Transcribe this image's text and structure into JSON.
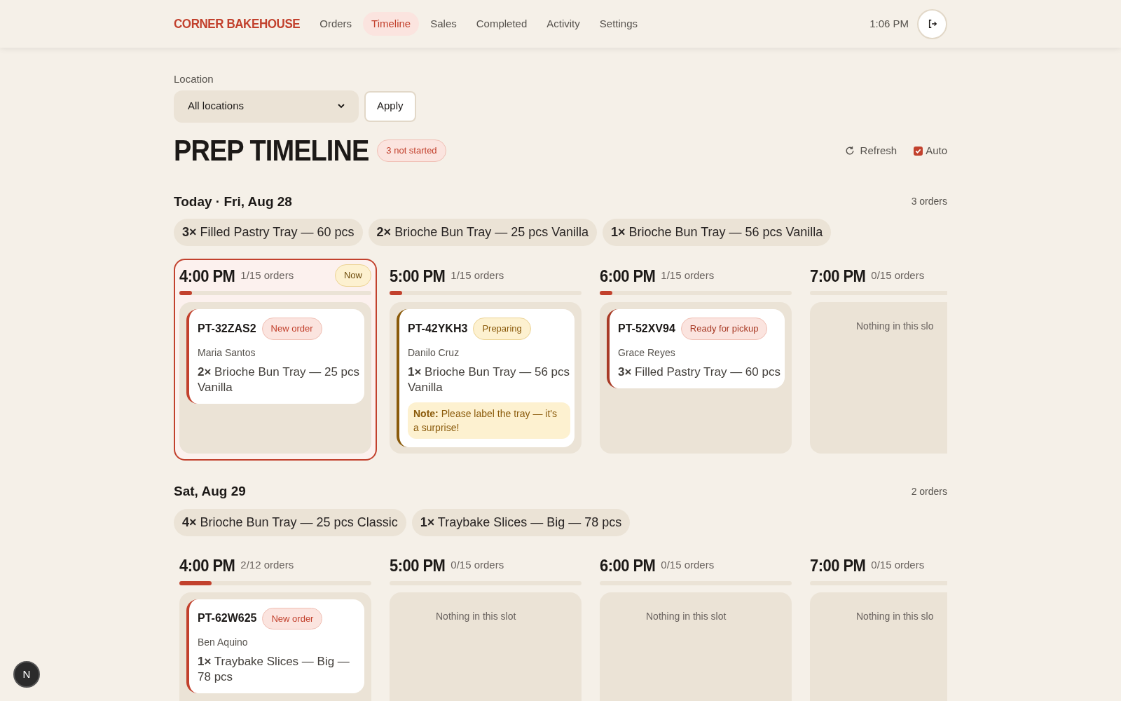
{
  "nav": {
    "brand": "CORNER BAKEHOUSE",
    "links": [
      {
        "label": "Orders",
        "selected": false
      },
      {
        "label": "Timeline",
        "selected": true
      },
      {
        "label": "Sales",
        "selected": false
      },
      {
        "label": "Completed",
        "selected": false
      },
      {
        "label": "Activity",
        "selected": false
      },
      {
        "label": "Settings",
        "selected": false
      }
    ],
    "time": "1:06 PM"
  },
  "filter": {
    "label": "Location",
    "value": "All locations",
    "button": "Apply"
  },
  "title": "PREP TIMELINE",
  "title_badge": "3 not started",
  "refresh": "Refresh",
  "auto": {
    "label": "Auto",
    "checked": true
  },
  "days": [
    {
      "heading": "Today · Fri, Aug 28",
      "count": "3 orders",
      "chips": [
        "**3×** Filled Pastry Tray — 60 pcs",
        "**2×** Brioche Bun Tray — 25 pcs Vanilla",
        "**1×** Brioche Bun Tray — 56 pcs Vanilla"
      ],
      "slots": [
        {
          "time": "4:00 PM",
          "capacity": "1/15 orders",
          "level": 0.067,
          "current": true,
          "badge": "Now",
          "orders": [
            {
              "code": "PT-32ZAS2",
              "status": {
                "label": "New order",
                "kind": "new"
              },
              "customer": "Maria Santos",
              "item": "**2×** Brioche Bun Tray — 25 pcs Vanilla"
            }
          ]
        },
        {
          "time": "5:00 PM",
          "capacity": "1/15 orders",
          "level": 0.067,
          "current": false,
          "orders": [
            {
              "code": "PT-42YKH3",
              "status": {
                "label": "Preparing",
                "kind": "preparing"
              },
              "customer": "Danilo Cruz",
              "item": "**1×** Brioche Bun Tray — 56 pcs Vanilla",
              "note": "**Note:** Please label the tray — it's a surprise!"
            }
          ]
        },
        {
          "time": "6:00 PM",
          "capacity": "1/15 orders",
          "level": 0.067,
          "current": false,
          "orders": [
            {
              "code": "PT-52XV94",
              "status": {
                "label": "Ready for pickup",
                "kind": "ready"
              },
              "customer": "Grace Reyes",
              "item": "**3×** Filled Pastry Tray — 60 pcs"
            }
          ]
        },
        {
          "time": "7:00 PM",
          "capacity": "0/15 orders",
          "current": false,
          "empty": "Nothing in this slo"
        }
      ]
    },
    {
      "heading": "Sat, Aug 29",
      "count": "2 orders",
      "chips": [
        "**4×** Brioche Bun Tray — 25 pcs Classic",
        "**1×** Traybake Slices — Big — 78 pcs"
      ],
      "slots": [
        {
          "time": "4:00 PM",
          "capacity": "2/12 orders",
          "level": 0.167,
          "current": false,
          "orders": [
            {
              "code": "PT-62W625",
              "status": {
                "label": "New order",
                "kind": "new"
              },
              "customer": "Ben Aquino",
              "item": "**1×** Traybake Slices — Big — 78 pcs"
            }
          ]
        },
        {
          "time": "5:00 PM",
          "capacity": "0/15 orders",
          "current": false,
          "empty": "Nothing in this slot"
        },
        {
          "time": "6:00 PM",
          "capacity": "0/15 orders",
          "current": false,
          "empty": "Nothing in this slot"
        },
        {
          "time": "7:00 PM",
          "capacity": "0/15 orders",
          "current": false,
          "empty": "Nothing in this slo"
        }
      ]
    }
  ],
  "dev_badge": "N"
}
